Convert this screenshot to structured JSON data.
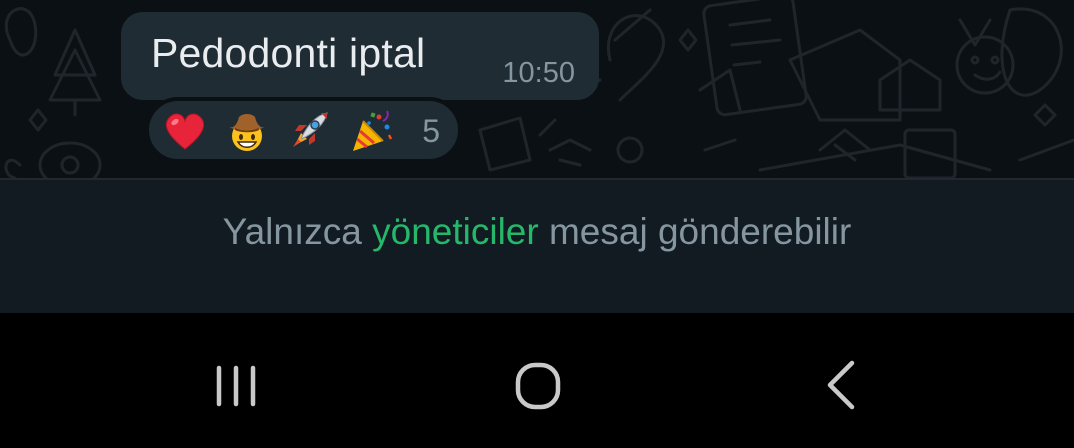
{
  "message": {
    "text": "Pedodonti iptal",
    "time": "10:50"
  },
  "reactions": {
    "items": [
      {
        "icon": "red-heart-icon"
      },
      {
        "icon": "cowboy-face-icon"
      },
      {
        "icon": "rocket-icon"
      },
      {
        "icon": "party-popper-icon"
      }
    ],
    "count": "5"
  },
  "notice": {
    "prefix": "Yalnızca ",
    "link": "yöneticiler",
    "suffix": " mesaj gönderebilir"
  },
  "navbar": {
    "buttons": [
      {
        "icon": "recent-apps-icon"
      },
      {
        "icon": "home-icon"
      },
      {
        "icon": "back-icon"
      }
    ]
  },
  "colors": {
    "chat_background": "#0b1014",
    "bubble": "#1f2c33",
    "accent_link": "#25b86a",
    "secondary_text": "#8696a0",
    "primary_text": "#e9edef"
  }
}
